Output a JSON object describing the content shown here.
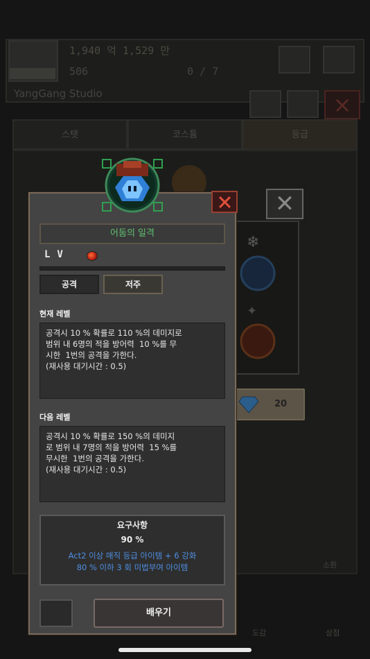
{
  "background": {
    "gold": "1,940 억 1,529 만",
    "gems": "506",
    "count": "0 / 7",
    "studio": "YangGang Studio",
    "tabs": [
      "스탯",
      "코스튬",
      "등급"
    ],
    "gem_cost": "20",
    "shop_label": "소환",
    "bottom_labels": [
      "도감",
      "상점"
    ]
  },
  "modal": {
    "skill_name": "어둠의 일격",
    "lv_label": "LV",
    "tabs": {
      "attack": "공격",
      "curse": "저주"
    },
    "current_level": {
      "label": "현재 레벨",
      "text": "공격시 10 % 확률로 110 %의 데미지로\n범위 내 6명의 적을 방어력  10 %를 무\n시한  1번의 공격을 가한다.\n(재사용 대기시간 : 0.5)"
    },
    "next_level": {
      "label": "다음 레벨",
      "text": "공격시 10 % 확률로 150 %의 데미지\n로 범위 내 7명의 적을 방어력  15 %를\n무시한  1번의 공격을 가한다.\n(재사용 대기시간 : 0.5)"
    },
    "requirements": {
      "title": "요구사항",
      "percent": "90 %",
      "text": "Act2 이상 매직 등급 아이템 + 6 강화\n80 % 이하 3 회 미법부여 아이템"
    },
    "learn_button": "배우기"
  },
  "colors": {
    "skill_name": "#5fbf6f",
    "requirement_text": "#4e8ee0",
    "close_red": "#e0503a"
  }
}
